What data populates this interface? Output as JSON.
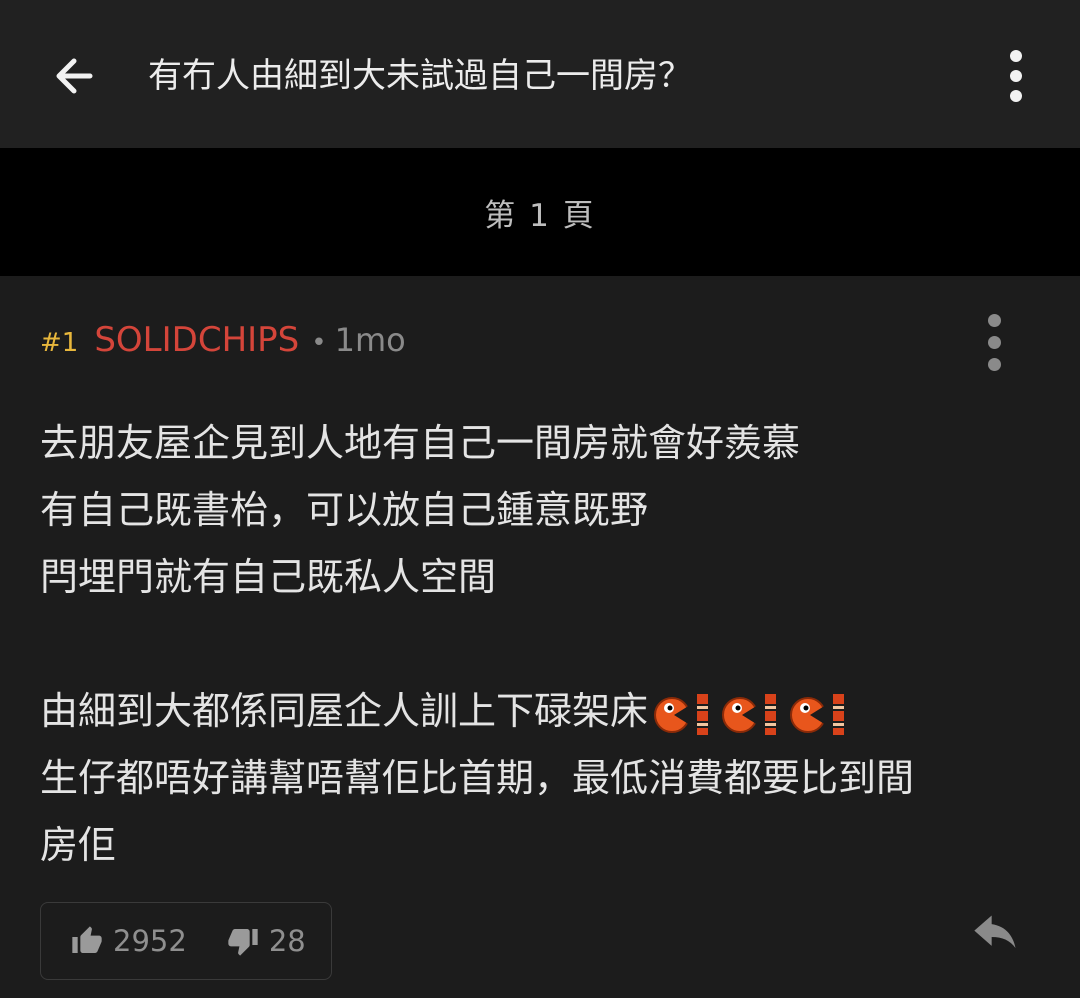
{
  "header": {
    "title": "有冇人由細到大未試過自己一間房？"
  },
  "pagination": {
    "label": "第 1 頁"
  },
  "post": {
    "number": "#1",
    "username": "SOLIDCHIPS",
    "separator": "•",
    "time": "1mo",
    "body_lines": [
      "去朋友屋企見到人地有自己一間房就會好羨慕",
      "有自己既書枱，可以放自己鍾意既野",
      "閂埋門就有自己既私人空間",
      "",
      "由細到大都係同屋企人訓上下碌架床",
      "生仔都唔好講幫唔幫佢比首期，最低消費都要比到間",
      "房佢"
    ],
    "emoji_icons": [
      "orange-pacman-brick-icon",
      "orange-pacman-brick-icon",
      "orange-pacman-brick-icon"
    ],
    "likes": "2952",
    "dislikes": "28"
  },
  "icons": {
    "back": "arrow-left-icon",
    "menu": "more-vertical-icon",
    "like": "thumbs-up-icon",
    "dislike": "thumbs-down-icon",
    "reply": "reply-arrow-icon"
  },
  "colors": {
    "post_number": "#e8b73c",
    "username": "#d4453a",
    "background": "#1c1c1c",
    "header_background": "#212121",
    "pagebar_background": "#000000"
  }
}
